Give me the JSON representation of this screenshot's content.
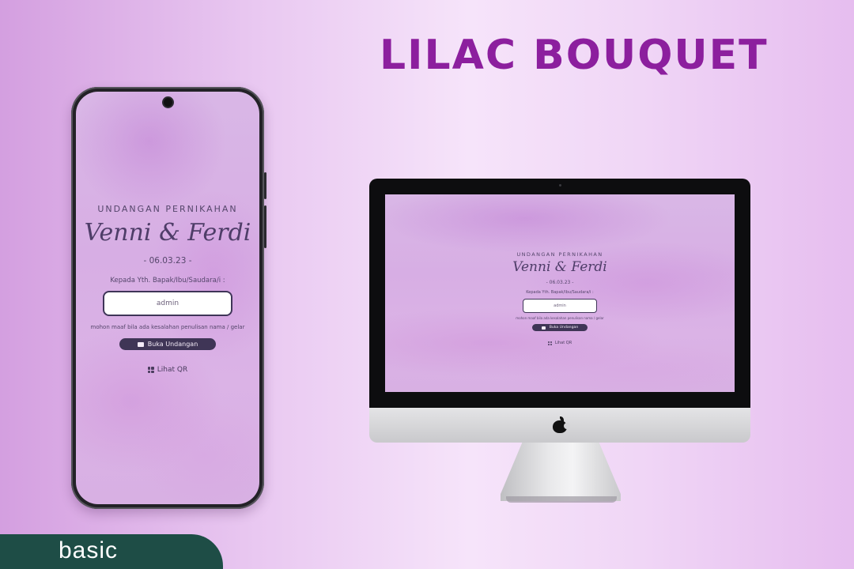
{
  "title": "LILAC BOUQUET",
  "badge": "basic",
  "colors": {
    "title": "#8c1f9e",
    "badge_bg": "#1e4d46",
    "button_bg": "#3f3556",
    "screen_bg": "#d9b7e6"
  },
  "invitation": {
    "eyebrow": "UNDANGAN PERNIKAHAN",
    "names": "Venni & Ferdi",
    "date": "- 06.03.23 -",
    "guest_label": "Kepada Yth. Bapak/Ibu/Saudara/i :",
    "guest_name": "admin",
    "note": "mohon maaf bila ada kesalahan penulisan nama / gelar",
    "open_button": "Buka Undangan",
    "qr_link": "Lihat QR"
  }
}
